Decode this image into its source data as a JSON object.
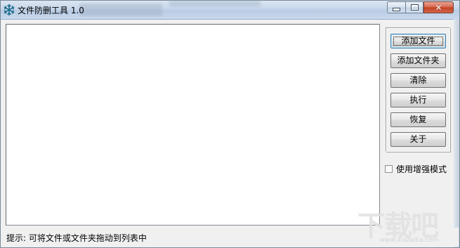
{
  "window": {
    "title": "文件防删工具 1.0",
    "app_icon": "snowflake-icon",
    "controls": {
      "minimize_icon": "minimize-icon",
      "maximize_icon": "maximize-icon",
      "close_icon": "close-icon",
      "close_glyph": "✕"
    }
  },
  "file_list": {
    "items": []
  },
  "buttons": {
    "add_file": "添加文件",
    "add_folder": "添加文件夹",
    "clear": "清除",
    "execute": "执行",
    "restore": "恢复",
    "about": "关于"
  },
  "options": {
    "enhanced_mode_label": "使用增强模式",
    "enhanced_mode_checked": false
  },
  "status": {
    "hint": "提示: 可将文件或文件夹拖动到列表中"
  },
  "watermark": {
    "text": "下载吧",
    "url": "www.xiazaiba.com"
  },
  "colors": {
    "titlebar": "#c6d6ea",
    "close_button": "#c2401f",
    "listbox_bg": "#ffffff",
    "window_bg": "#f0f0f0"
  }
}
